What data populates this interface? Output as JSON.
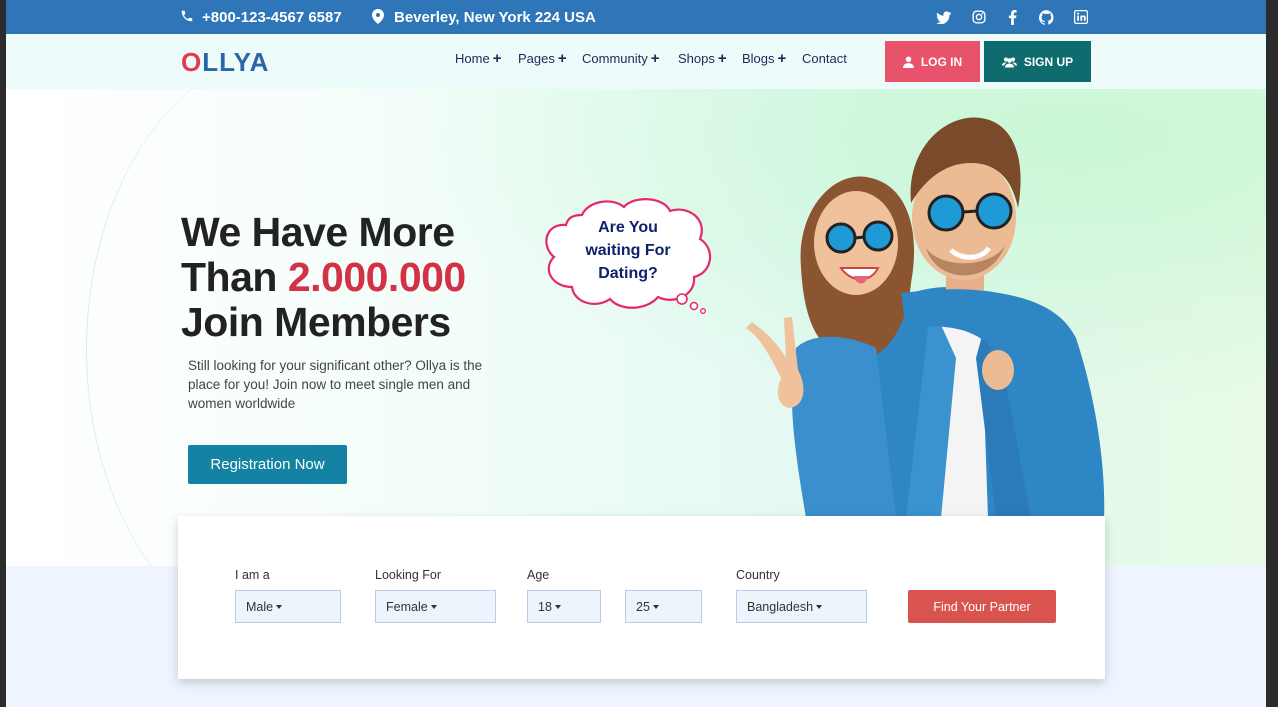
{
  "topbar": {
    "phone": "+800-123-4567 6587",
    "address": "Beverley, New York 224 USA",
    "social_icons": [
      "twitter-icon",
      "instagram-icon",
      "facebook-icon",
      "github-icon",
      "linkedin-icon"
    ]
  },
  "brand": {
    "logo_first": "O",
    "logo_rest": "LLYA",
    "logo_color": "#2b65a8",
    "logo_accent": "#e23a52"
  },
  "nav": {
    "items": [
      {
        "label": "Home",
        "has_submenu": true
      },
      {
        "label": "Pages",
        "has_submenu": true
      },
      {
        "label": "Community",
        "has_submenu": true
      },
      {
        "label": "Shops",
        "has_submenu": true
      },
      {
        "label": "Blogs",
        "has_submenu": true
      },
      {
        "label": "Contact",
        "has_submenu": false
      }
    ],
    "login_label": "LOG IN",
    "signup_label": "SIGN UP"
  },
  "hero": {
    "headline_line1": "We Have More",
    "headline_line2_prefix": "Than ",
    "headline_highlight": "2.000.000",
    "headline_line3": "Join Members",
    "subtitle": "Still looking for your significant other? Ollya is the place for you! Join now to meet single men and women worldwide",
    "cta_label": "Registration Now",
    "bubble_line1": "Are You",
    "bubble_line2": "waiting For",
    "bubble_line3": "Dating?"
  },
  "search": {
    "iam_label": "I am a",
    "iam_value": "Male",
    "looking_label": "Looking For",
    "looking_value": "Female",
    "age_label": "Age",
    "age_from": "18",
    "age_to": "25",
    "country_label": "Country",
    "country_value": "Bangladesh",
    "submit_label": "Find Your Partner"
  },
  "colors": {
    "topbar": "#2e76b8",
    "accent_red": "#d33146",
    "login": "#e8536b",
    "signup": "#0f6c6e",
    "cta": "#1382a3",
    "find": "#d9534f"
  }
}
